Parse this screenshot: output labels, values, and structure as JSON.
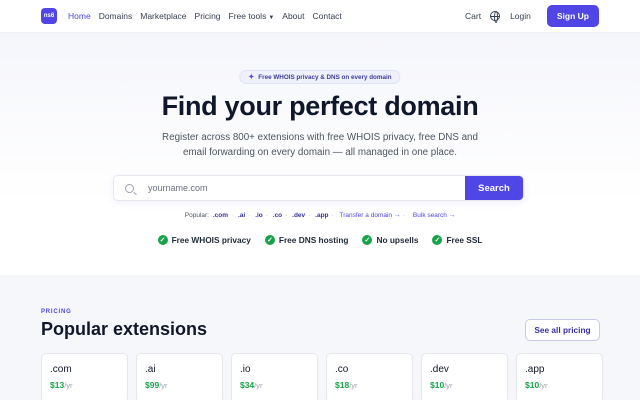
{
  "nav": {
    "logo": "ns6",
    "links": [
      {
        "label": "Home",
        "active": true
      },
      {
        "label": "Domains"
      },
      {
        "label": "Marketplace"
      },
      {
        "label": "Pricing"
      },
      {
        "label": "Free tools"
      },
      {
        "label": "About"
      },
      {
        "label": "Contact"
      }
    ],
    "cart": "Cart",
    "login": "Login",
    "signup": "Sign Up"
  },
  "hero": {
    "badge": "Free WHOIS privacy & DNS on every domain",
    "title": "Find your perfect domain",
    "subtitle": "Register across 800+ extensions with free WHOIS privacy, free DNS and email forwarding on every domain — all managed in one place.",
    "search": {
      "placeholder": "yourname.com",
      "button": "Search"
    },
    "popular_label": "Popular:",
    "popular_tlds": [
      ".com",
      ".ai",
      ".io",
      ".co",
      ".dev",
      ".app"
    ],
    "transfer_link": "Transfer a domain →",
    "bulk_link": "Bulk search →",
    "features": [
      "Free WHOIS privacy",
      "Free DNS hosting",
      "No upsells",
      "Free SSL"
    ]
  },
  "pricing": {
    "eyebrow": "PRICING",
    "title": "Popular extensions",
    "see_all": "See all pricing",
    "per": "/yr",
    "cards": [
      {
        "ext": ".com",
        "price": "$13"
      },
      {
        "ext": ".ai",
        "price": "$99"
      },
      {
        "ext": ".io",
        "price": "$34"
      },
      {
        "ext": ".co",
        "price": "$18"
      },
      {
        "ext": ".dev",
        "price": "$10"
      },
      {
        "ext": ".app",
        "price": "$10"
      }
    ]
  },
  "colors": {
    "accent": "#4f46e5",
    "success": "#16a34a"
  }
}
